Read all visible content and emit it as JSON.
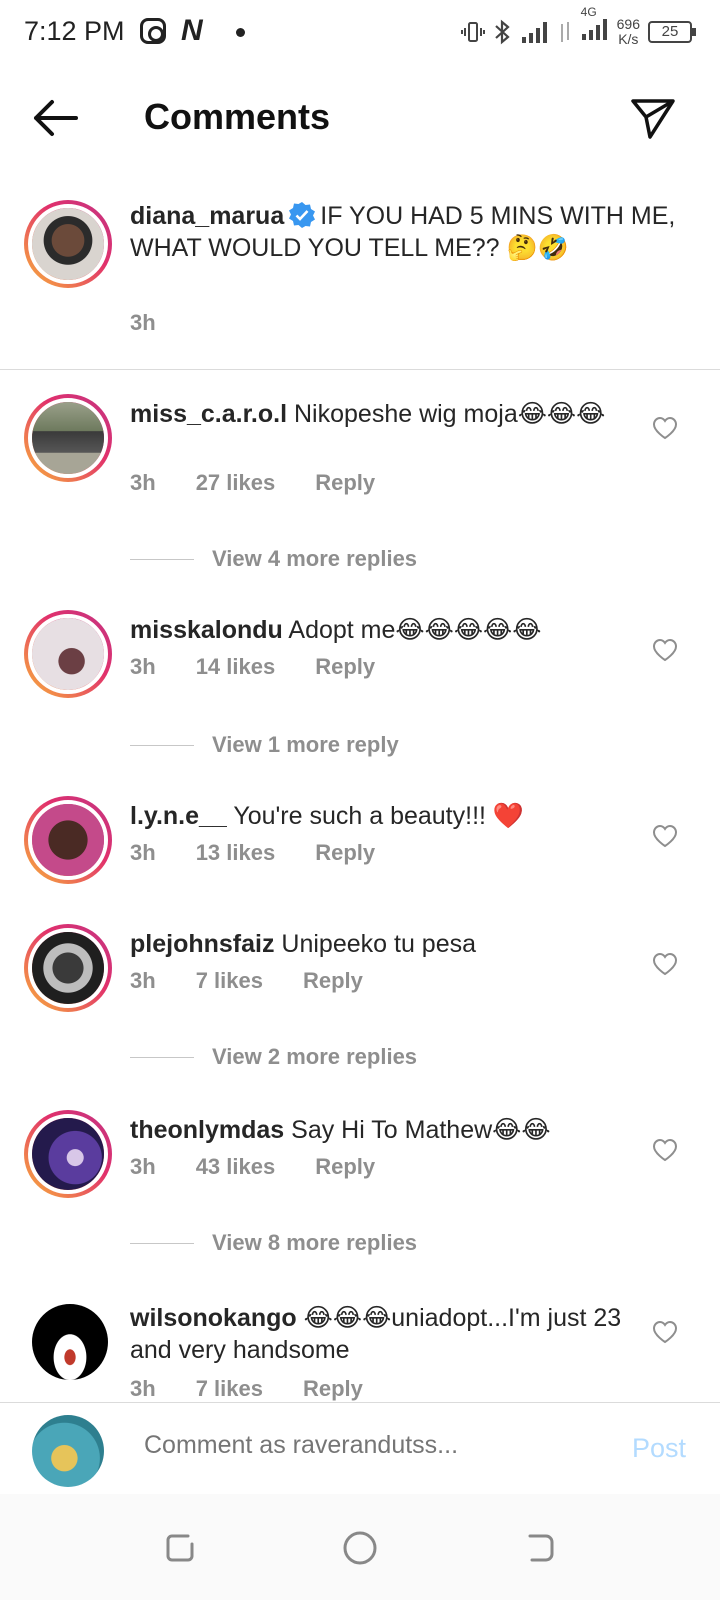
{
  "status": {
    "time": "7:12 PM",
    "net_app_letter": "N",
    "network": "4G",
    "speed_value": "696",
    "speed_unit": "K/s",
    "battery": "25"
  },
  "header": {
    "title": "Comments"
  },
  "caption": {
    "username": "diana_marua",
    "text": "IF YOU HAD 5 MINS WITH ME, WHAT WOULD YOU TELL ME?? 🤔🤣",
    "time": "3h"
  },
  "comments": [
    {
      "username": "miss_c.a.r.o.l",
      "text": "Nikopeshe wig moja😂😂😂",
      "time": "3h",
      "likes": "27 likes",
      "reply": "Reply",
      "view_replies": "View 4 more replies"
    },
    {
      "username": "misskalondu",
      "text": "Adopt me😂😂😂😂😂",
      "time": "3h",
      "likes": "14 likes",
      "reply": "Reply",
      "view_replies": "View 1 more reply"
    },
    {
      "username": "l.y.n.e__",
      "text": "You're such a beauty!!! ❤️",
      "time": "3h",
      "likes": "13 likes",
      "reply": "Reply",
      "view_replies": ""
    },
    {
      "username": "plejohnsfaiz",
      "text": "Unipeeko tu pesa",
      "time": "3h",
      "likes": "7 likes",
      "reply": "Reply",
      "view_replies": "View 2 more replies"
    },
    {
      "username": "theonlymdas",
      "text": "Say Hi To Mathew😂😂",
      "time": "3h",
      "likes": "43 likes",
      "reply": "Reply",
      "view_replies": "View 8 more replies"
    },
    {
      "username": "wilsonokango",
      "text": "😂😂😂uniadopt...I'm just 23 and very handsome",
      "time": "3h",
      "likes": "7 likes",
      "reply": "Reply",
      "view_replies": ""
    }
  ],
  "composer": {
    "placeholder": "Comment as raverandutss...",
    "post_label": "Post"
  },
  "icons": {
    "back": "arrow-left-icon",
    "send": "paper-plane-icon",
    "verified": "verified-badge-icon",
    "heart": "heart-outline-icon"
  },
  "colors": {
    "verified_blue": "#3897f0",
    "secondary_text": "#8e8e8e",
    "post_disabled": "#b3dbff"
  }
}
